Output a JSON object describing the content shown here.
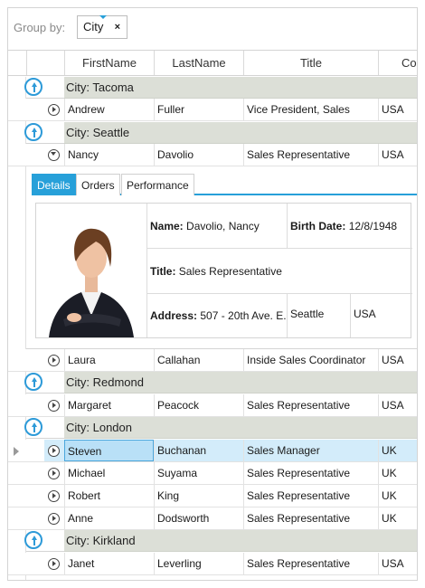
{
  "group_panel": {
    "label": "Group by:",
    "chip": "City",
    "close": "×"
  },
  "columns": [
    "FirstName",
    "LastName",
    "Title",
    "Country"
  ],
  "groups": [
    {
      "label": "City: Tacoma"
    },
    {
      "label": "City: Seattle"
    },
    {
      "label": "City: Redmond"
    },
    {
      "label": "City: London"
    },
    {
      "label": "City: Kirkland"
    }
  ],
  "rows": [
    {
      "first": "Andrew",
      "last": "Fuller",
      "title": "Vice President, Sales",
      "country": "USA"
    },
    {
      "first": "Nancy",
      "last": "Davolio",
      "title": "Sales Representative",
      "country": "USA"
    },
    {
      "first": "Laura",
      "last": "Callahan",
      "title": "Inside Sales Coordinator",
      "country": "USA"
    },
    {
      "first": "Margaret",
      "last": "Peacock",
      "title": "Sales Representative",
      "country": "USA"
    },
    {
      "first": "Steven",
      "last": "Buchanan",
      "title": "Sales Manager",
      "country": "UK"
    },
    {
      "first": "Michael",
      "last": "Suyama",
      "title": "Sales Representative",
      "country": "UK"
    },
    {
      "first": "Robert",
      "last": "King",
      "title": "Sales Representative",
      "country": "UK"
    },
    {
      "first": "Anne",
      "last": "Dodsworth",
      "title": "Sales Representative",
      "country": "UK"
    },
    {
      "first": "Janet",
      "last": "Leverling",
      "title": "Sales Representative",
      "country": "USA"
    }
  ],
  "details": {
    "tabs": [
      "Details",
      "Orders",
      "Performance"
    ],
    "name_label": "Name:",
    "name_value": "Davolio, Nancy",
    "birth_label": "Birth Date:",
    "birth_value": "12/8/1948",
    "title_label": "Title:",
    "title_value": "Sales Representative",
    "address_label": "Address:",
    "address_value": "507 - 20th Ave. E.",
    "city": "Seattle",
    "country": "USA"
  },
  "colors": {
    "accent": "#27a0d9",
    "group_band": "#dcdfd7",
    "selected": "#d3ecfa"
  }
}
